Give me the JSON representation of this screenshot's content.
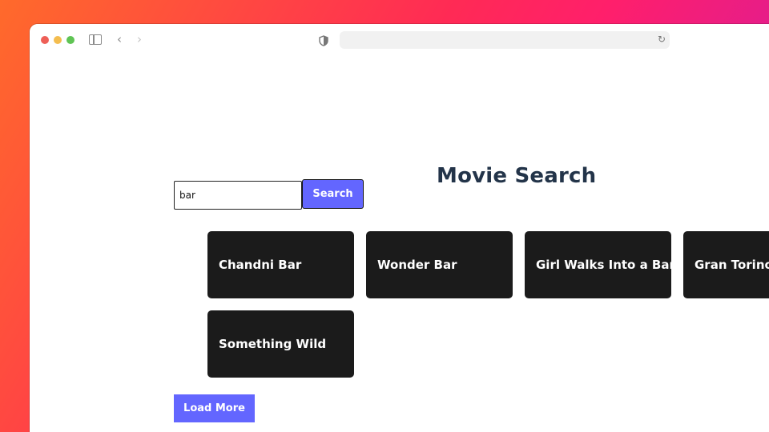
{
  "browser": {
    "url": "",
    "icons": {
      "sidebar": "sidebar-icon",
      "back": "chevron-left-icon",
      "forward": "chevron-right-icon",
      "privacy": "shield-icon",
      "reload": "reload-icon"
    },
    "back_glyph": "‹",
    "forward_glyph": "›",
    "reload_glyph": "↻"
  },
  "page": {
    "title": "Movie Search"
  },
  "search": {
    "value": "bar",
    "button_label": "Search"
  },
  "results": [
    {
      "title": "Chandni Bar"
    },
    {
      "title": "Wonder Bar"
    },
    {
      "title": "Girl Walks Into a Bar"
    },
    {
      "title": "Gran Torino"
    },
    {
      "title": "Something Wild"
    }
  ],
  "load_more_label": "Load More",
  "colors": {
    "accent": "#6366ff",
    "card_bg": "#1b1b1b",
    "title": "#233449"
  }
}
